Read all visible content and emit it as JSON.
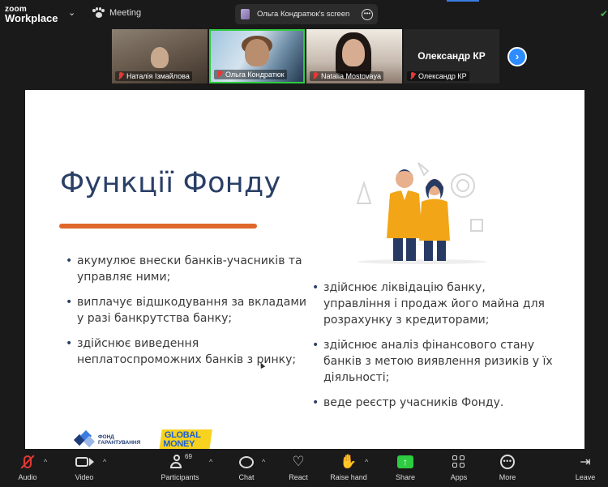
{
  "app": {
    "brand_top": "zoom",
    "brand_bottom": "Workplace",
    "meeting_label": "Meeting",
    "shared_screen_label": "Ольга Кондратюк's screen"
  },
  "participants": [
    {
      "name": "Наталія Ізмайлова",
      "muted": true
    },
    {
      "name": "Ольга Кондратюк",
      "muted": true,
      "active_speaker": true
    },
    {
      "name": "Natalia Mostovaya",
      "muted": true
    },
    {
      "name": "Олександр КР",
      "display_name": "Олександр КР",
      "muted": true,
      "video": false
    }
  ],
  "slide": {
    "title": "Функції Фонду",
    "bullets_left": [
      "акумулює внески банків-учасників та управляє ними;",
      "виплачує відшкодування за вкладами у разі банкрутства банку;",
      "здійснює виведення неплатоспроможних банків з ринку;"
    ],
    "bullets_right": [
      "здійснює ліквідацію банку, управління і продаж його майна для розрахунку з кредиторами;",
      "здійснює аналіз фінансового стану банків з метою виявлення ризиків у їх діяльності;",
      "веде реєстр учасників Фонду."
    ],
    "logo_fund_line1": "ФОНД",
    "logo_fund_line2": "ГАРАНТУВАННЯ",
    "logo_money_line1": "GLOBAL",
    "logo_money_line2": "MONEY"
  },
  "toolbar": {
    "audio": "Audio",
    "video": "Video",
    "participants": "Participants",
    "participants_count": "69",
    "chat": "Chat",
    "react": "React",
    "raise_hand": "Raise hand",
    "share": "Share",
    "apps": "Apps",
    "more": "More",
    "leave": "Leave"
  },
  "colors": {
    "title": "#2a3f66",
    "accent_line": "#e0662a",
    "share_green": "#2ecc40",
    "muted_red": "#e53935",
    "active_speaker_border": "#2ecc40",
    "next_button": "#2d8cff"
  }
}
